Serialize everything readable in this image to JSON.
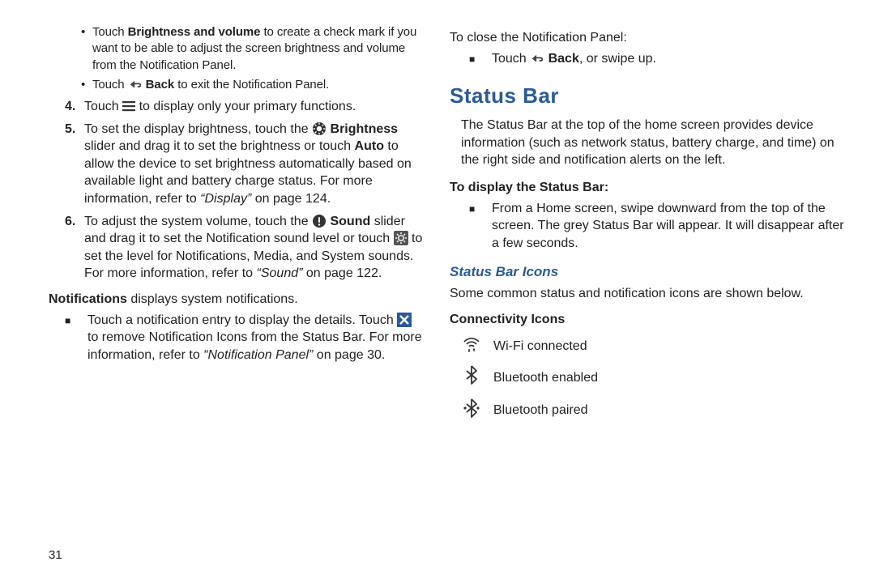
{
  "left": {
    "b1_pre": "Touch ",
    "b1_bold": "Brightness and volume",
    "b1_post": " to create a check mark if you want to be able to adjust the screen brightness and volume from the Notification Panel.",
    "b2_pre": "Touch ",
    "b2_bold": " Back",
    "b2_post": " to exit the Notification Panel.",
    "n4_pre": "Touch ",
    "n4_post": " to display only your primary functions.",
    "n5_pre": "To set the display brightness, touch the ",
    "n5_bold": " Brightness",
    "n5_mid": " slider and drag it to set the brightness or touch ",
    "n5_auto": "Auto",
    "n5_post": " to allow the device to set brightness automatically based on available light and battery charge status. For more information, refer to ",
    "n5_ref": "“Display”",
    "n5_pg": " on page 124.",
    "n6_pre": "To adjust the system volume, touch the ",
    "n6_bold": " Sound",
    "n6_mid": " slider and drag it to set the Notification sound level or touch ",
    "n6_post": " to set the level for Notifications, Media, and System sounds. For more information, refer to ",
    "n6_ref": "“Sound”",
    "n6_pg": " on page 122.",
    "notif_bold": "Notifications",
    "notif_post": " displays system notifications.",
    "sq1_pre": "Touch a notification entry to display the details. Touch ",
    "sq1_post": " to remove Notification Icons from the Status Bar. For more information, refer to ",
    "sq1_ref": "“Notification Panel”",
    "sq1_pg": " on page 30.",
    "page_no": "31",
    "n4": "4.",
    "n5": "5.",
    "n6": "6."
  },
  "right": {
    "close_title": "To close the Notification Panel:",
    "close_pre": "Touch ",
    "close_bold": " Back",
    "close_post": ", or swipe up.",
    "h1": "Status Bar",
    "para": "The Status Bar at the top of the home screen provides device information (such as network status, battery charge, and time) on the right side and notification alerts on the left.",
    "display_title": "To display the Status Bar:",
    "display_body": "From a Home screen, swipe downward from the top of the screen. The grey Status Bar will appear. It will disappear after a few seconds.",
    "h2": "Status Bar Icons",
    "icons_para": "Some common status and notification icons are shown below.",
    "conn_title": "Connectivity Icons",
    "wifi": "Wi-Fi connected",
    "bt_en": "Bluetooth enabled",
    "bt_pair": "Bluetooth paired"
  }
}
